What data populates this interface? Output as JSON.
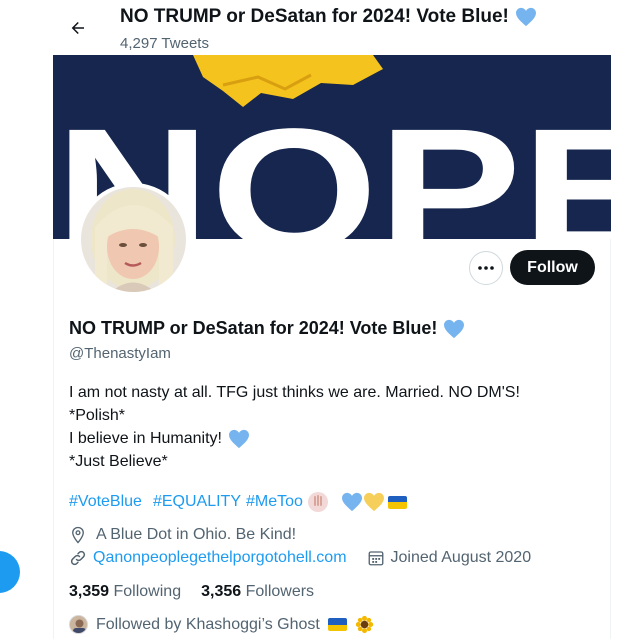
{
  "header": {
    "back_icon": "arrow-left-icon",
    "title": "NO TRUMP or DeSatan for 2024! Vote Blue!",
    "tweet_count": "4,297 Tweets"
  },
  "banner": {
    "text": "NOPE",
    "bg_color": "#16264f",
    "hair_color": "#f5c31d"
  },
  "profile": {
    "name": "NO TRUMP or DeSatan for 2024! Vote Blue!",
    "handle": "@ThenastyIam",
    "follow_label": "Follow",
    "more_icon": "more-dots-icon"
  },
  "bio": {
    "line1": "I am not nasty at all. TFG just thinks we are. Married.  NO DM'S!",
    "line2": "*Polish*",
    "line3": "I believe in Humanity!",
    "line4": "*Just Believe*"
  },
  "hashtags": {
    "tag1": "#VoteBlue",
    "tag2": "#EQUALITY",
    "tag3": "#MeToo"
  },
  "meta": {
    "location_icon": "location-pin-icon",
    "location": "A Blue Dot in Ohio.  Be Kind!",
    "link_icon": "link-icon",
    "link": "Qanonpeoplegethelporgotohell.com",
    "calendar_icon": "calendar-icon",
    "joined": "Joined August 2020"
  },
  "stats": {
    "following_count": "3,359",
    "following_label": "Following",
    "followers_count": "3,356",
    "followers_label": "Followers"
  },
  "followed_by": {
    "text": "Followed by Khashoggi’s Ghost"
  },
  "colors": {
    "accent": "#1d9bf0",
    "heart_blue": "#76b4ef",
    "heart_yellow": "#f6cf5b",
    "text_secondary": "#536471"
  }
}
